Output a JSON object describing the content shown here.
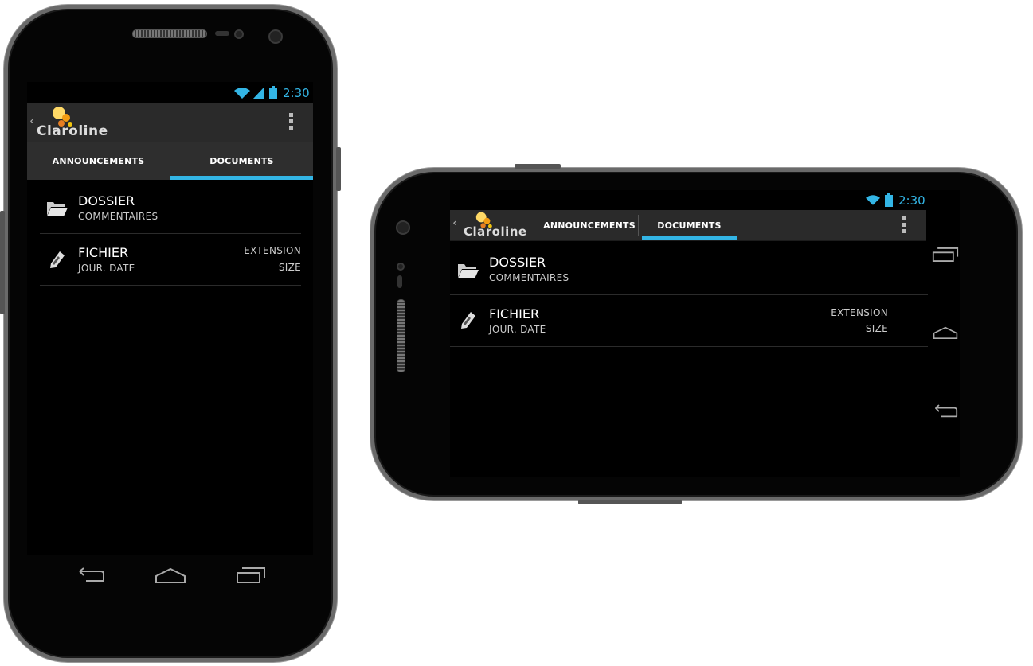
{
  "status": {
    "time": "2:30"
  },
  "app": {
    "logo_text": "Claroline"
  },
  "tabs": [
    {
      "label": "ANNOUNCEMENTS",
      "selected": false
    },
    {
      "label": "DOCUMENTS",
      "selected": true
    }
  ],
  "items": [
    {
      "icon": "folder-icon",
      "title": "DOSSIER",
      "subtitle": "COMMENTAIRES"
    },
    {
      "icon": "pencil-icon",
      "title": "FICHIER",
      "subtitle": "JOUR. DATE",
      "right_top": "EXTENSION",
      "right_bottom": "SIZE"
    }
  ],
  "colors": {
    "accent": "#33b5e5",
    "background": "#000000",
    "actionbar": "#2a2a2a"
  },
  "nav_icons": [
    "back-icon",
    "home-icon",
    "recent-apps-icon"
  ]
}
